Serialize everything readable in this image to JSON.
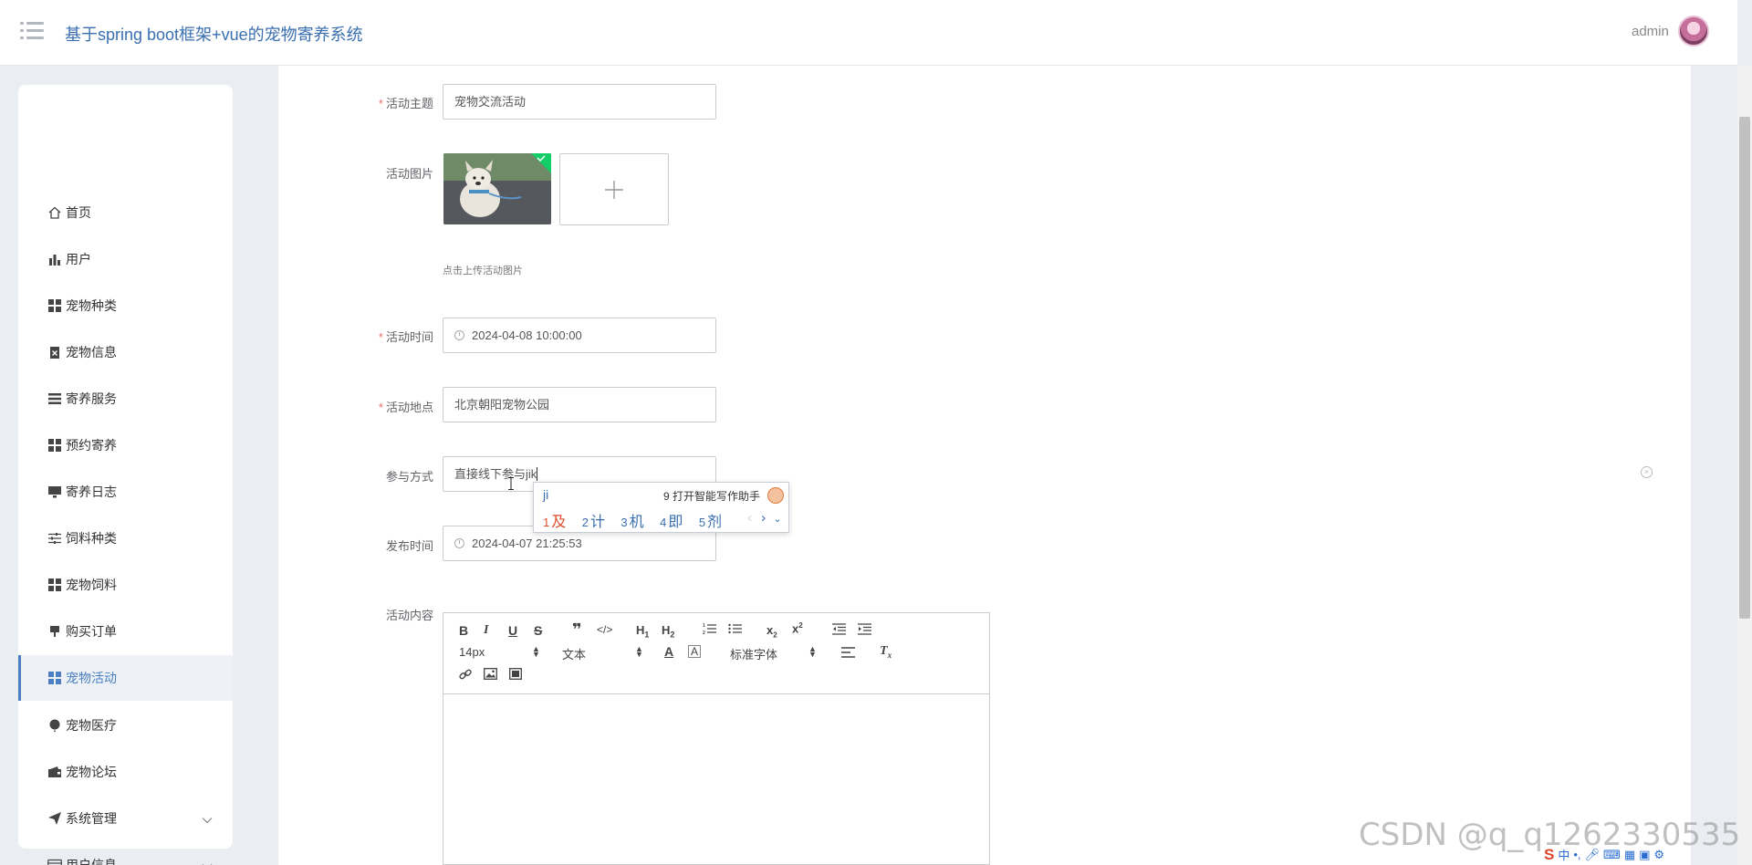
{
  "header": {
    "title": "基于spring boot框架+vue的宠物寄养系统",
    "username": "admin"
  },
  "sidebar": {
    "items": [
      {
        "label": "首页",
        "icon": "home-icon"
      },
      {
        "label": "用户",
        "icon": "bar-chart-icon"
      },
      {
        "label": "宠物种类",
        "icon": "grid-icon"
      },
      {
        "label": "宠物信息",
        "icon": "clipboard-icon"
      },
      {
        "label": "寄养服务",
        "icon": "list-icon"
      },
      {
        "label": "预约寄养",
        "icon": "grid-icon"
      },
      {
        "label": "寄养日志",
        "icon": "monitor-icon"
      },
      {
        "label": "饲料种类",
        "icon": "sliders-icon"
      },
      {
        "label": "宠物饲料",
        "icon": "grid-icon"
      },
      {
        "label": "购买订单",
        "icon": "stamp-icon"
      },
      {
        "label": "宠物活动",
        "icon": "grid-icon",
        "active": true
      },
      {
        "label": "宠物医疗",
        "icon": "balloon-icon"
      },
      {
        "label": "宠物论坛",
        "icon": "wallet-icon"
      },
      {
        "label": "系统管理",
        "icon": "send-icon",
        "expandable": true
      },
      {
        "label": "用户信息",
        "icon": "card-icon",
        "expandable": true
      }
    ]
  },
  "form": {
    "theme_label": "活动主题",
    "theme_value": "宠物交流活动",
    "image_label": "活动图片",
    "upload_hint": "点击上传活动图片",
    "time_label": "活动时间",
    "time_value": "2024-04-08 10:00:00",
    "location_label": "活动地点",
    "location_value": "北京朝阳宠物公园",
    "method_label": "参与方式",
    "method_value": "直接线下参与jik",
    "publish_label": "发布时间",
    "publish_value": "2024-04-07 21:25:53",
    "content_label": "活动内容",
    "required_mark": "*"
  },
  "editor": {
    "font_size": "14px",
    "text_type": "文本",
    "font_family": "标准字体"
  },
  "ime": {
    "composition": "ji",
    "assist": "9 打开智能写作助手",
    "candidates": [
      {
        "num": "1",
        "text": "及"
      },
      {
        "num": "2",
        "text": "计"
      },
      {
        "num": "3",
        "text": "机"
      },
      {
        "num": "4",
        "text": "即"
      },
      {
        "num": "5",
        "text": "剂"
      }
    ]
  },
  "watermark": "CSDN @q_q1262330535",
  "colors": {
    "accent": "#4a7fc1",
    "title": "#3a6fb0",
    "required": "#f56c6c",
    "background": "#eaedf1"
  }
}
